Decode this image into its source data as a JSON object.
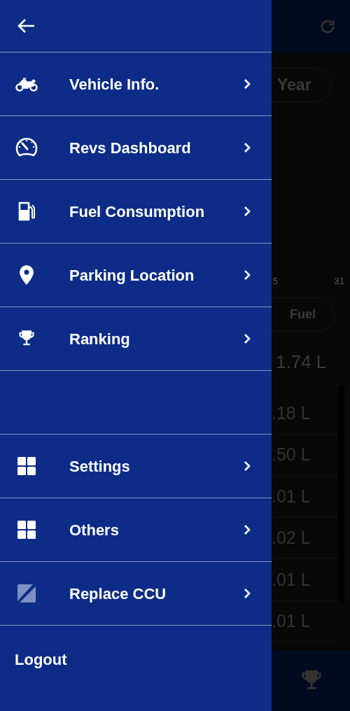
{
  "drawer": {
    "main_items": [
      {
        "label": "Vehicle Info."
      },
      {
        "label": "Revs Dashboard"
      },
      {
        "label": "Fuel Consumption"
      },
      {
        "label": "Parking Location"
      },
      {
        "label": "Ranking"
      }
    ],
    "secondary_items": [
      {
        "label": "Settings"
      },
      {
        "label": "Others"
      },
      {
        "label": "Replace CCU"
      }
    ],
    "logout": "Logout"
  },
  "background": {
    "period_tab": "Year",
    "axis_labels": [
      "5",
      "31"
    ],
    "metric_tab": "Fuel",
    "total": "1.74 L",
    "readings": [
      ".18 L",
      ".50 L",
      ".01 L",
      ".02 L",
      ".01 L",
      ".01 L"
    ]
  }
}
